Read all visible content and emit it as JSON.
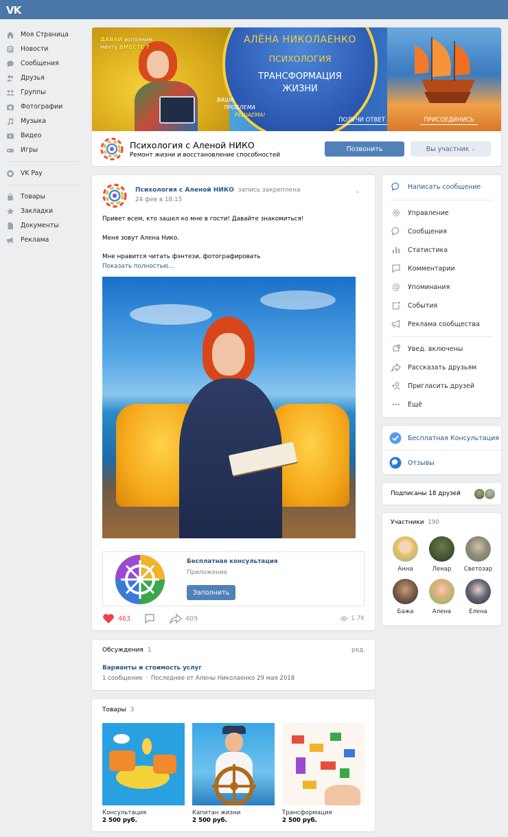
{
  "brand": {
    "logo": "VK",
    "accent": "#4a76a8",
    "link": "#2a5885",
    "button": "#5181b8",
    "background": "#edeef0"
  },
  "nav": {
    "items": [
      {
        "label": "Моя Страница",
        "icon": "home-icon"
      },
      {
        "label": "Новости",
        "icon": "news-icon"
      },
      {
        "label": "Сообщения",
        "icon": "messages-icon"
      },
      {
        "label": "Друзья",
        "icon": "friends-icon"
      },
      {
        "label": "Группы",
        "icon": "groups-icon"
      },
      {
        "label": "Фотографии",
        "icon": "photos-icon"
      },
      {
        "label": "Музыка",
        "icon": "music-icon"
      },
      {
        "label": "Видео",
        "icon": "video-icon"
      },
      {
        "label": "Игры",
        "icon": "games-icon"
      }
    ],
    "pay": {
      "label": "VK Pay",
      "icon": "vkpay-icon"
    },
    "extra": [
      {
        "label": "Товары",
        "icon": "market-icon"
      },
      {
        "label": "Закладки",
        "icon": "bookmarks-icon"
      },
      {
        "label": "Документы",
        "icon": "documents-icon"
      },
      {
        "label": "Реклама",
        "icon": "ads-icon"
      }
    ]
  },
  "cover": {
    "slogan_1": "ДАВАЙ",
    "slogan_2": "исполним",
    "slogan_3": "мечту",
    "slogan_4": "ВМЕСТЕ ?",
    "name": "АЛЁНА НИКОЛАЕНКО",
    "subject": "ПСИХОЛОГИЯ",
    "tagline_1": "ТРАНСФОРМАЦИЯ",
    "tagline_2": "ЖИЗНИ",
    "problem_1": "ВАША",
    "problem_2": "ПРОБЛЕМА",
    "problem_3": "РЕШАЕМА!",
    "answer": "ПОЛУЧИ ОТВЕТ",
    "join": "ПРИСОЕДИНИСЬ"
  },
  "group": {
    "name": "Психология с Аленой НИКО",
    "status": "Ремонт жизни и восстановление способностей",
    "call_button": "Позвонить",
    "member_button": "Вы участник"
  },
  "post": {
    "author": "Психология с Аленой НИКО",
    "pinned": "запись закреплена",
    "date": "24 фев в 18:15",
    "line1": "Привет всем, кто зашел ко мне в гости! Давайте знакомиться!",
    "line2": "Меня зовут Алена Нико.",
    "line3": "Мне нравится читать фэнтези, фотографировать",
    "more": "Показать полностью…",
    "app": {
      "title": "Бесплатная консультация",
      "subtitle": "Приложение",
      "button": "Заполнить"
    },
    "likes": "463",
    "shares": "409",
    "views": "1.7K"
  },
  "discussions": {
    "title": "Обсуждения",
    "count": "1",
    "edit": "ред.",
    "topic": "Варианты и стоимость услуг",
    "count_msgs": "1 сообщение",
    "separator": "·",
    "last": "Последнее от Алены Николаенко 29 мая 2018"
  },
  "market": {
    "title": "Товары",
    "count": "3",
    "items": [
      {
        "name": "Консультация",
        "price": "2 500 руб."
      },
      {
        "name": "Капитан жизни",
        "price": "2 500 руб."
      },
      {
        "name": "Трансформация",
        "price": "2 500 руб."
      }
    ]
  },
  "actions": {
    "write": "Написать сообщение",
    "items": [
      {
        "label": "Управление",
        "icon": "gear-icon"
      },
      {
        "label": "Сообщения",
        "icon": "chat-icon"
      },
      {
        "label": "Статистика",
        "icon": "stats-icon"
      },
      {
        "label": "Комментарии",
        "icon": "comment-icon"
      },
      {
        "label": "Упоминания",
        "icon": "at-icon"
      },
      {
        "label": "События",
        "icon": "calendar-icon"
      },
      {
        "label": "Реклама сообщества",
        "icon": "megaphone-icon"
      }
    ],
    "items2": [
      {
        "label": "Увед. включены",
        "icon": "bell-check-icon"
      },
      {
        "label": "Рассказать друзьям",
        "icon": "share-icon"
      },
      {
        "label": "Пригласить друзей",
        "icon": "invite-icon"
      },
      {
        "label": "Ещё",
        "icon": "more-icon"
      }
    ]
  },
  "links": {
    "consult": "Бесплатная Консультация",
    "reviews": "Отзывы"
  },
  "friends": {
    "label": "Подписаны 18 друзей"
  },
  "members": {
    "title": "Участники",
    "count": "190",
    "people": [
      {
        "name": "Анна"
      },
      {
        "name": "Ленар"
      },
      {
        "name": "Светозар"
      },
      {
        "name": "Бажа"
      },
      {
        "name": "Алена"
      },
      {
        "name": "Елена"
      }
    ]
  }
}
